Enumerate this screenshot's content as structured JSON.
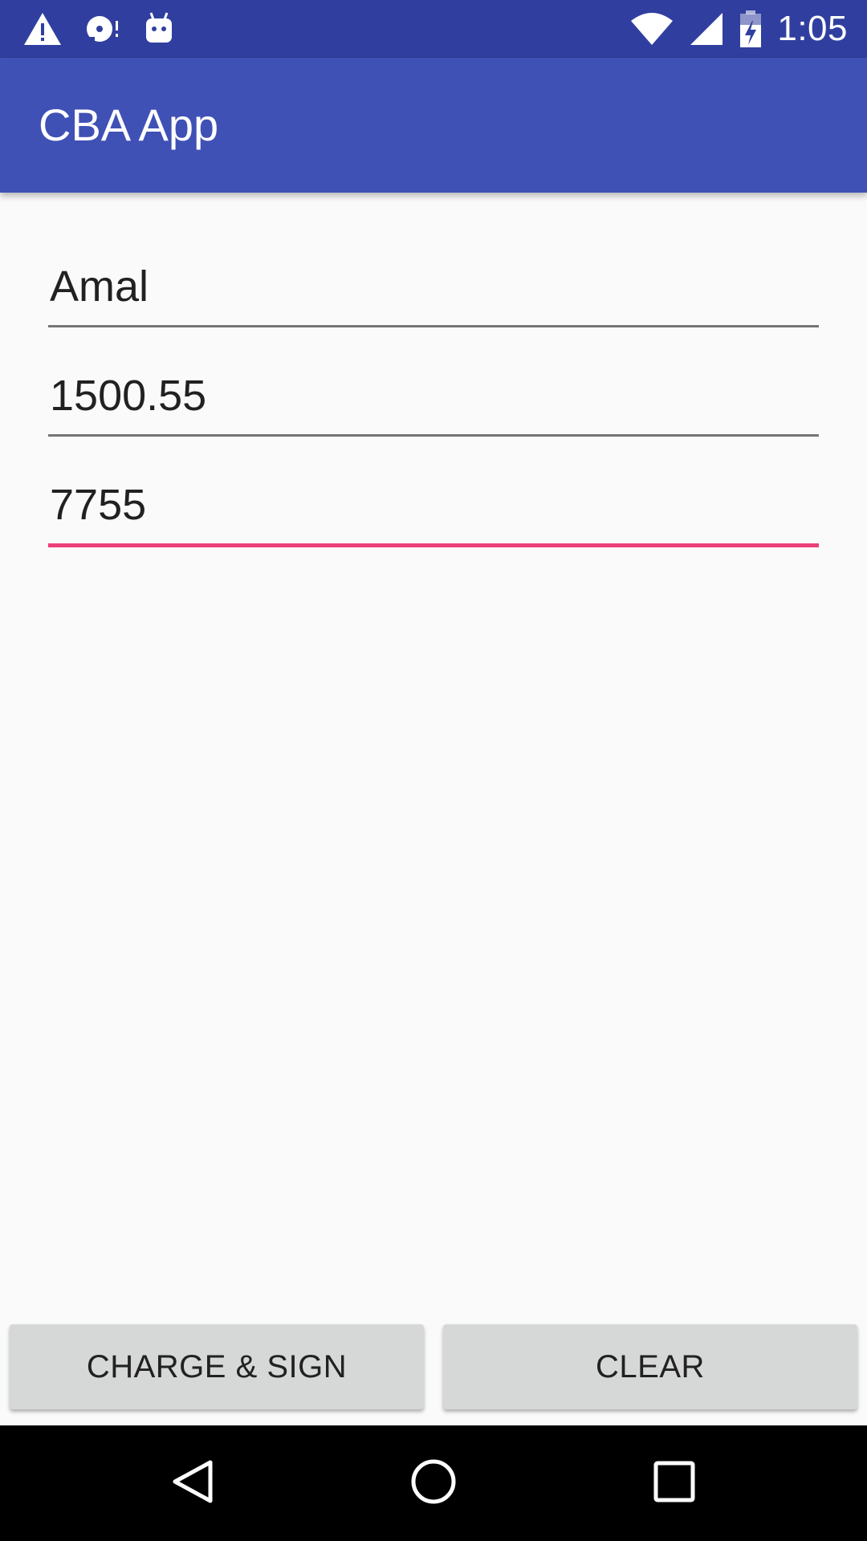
{
  "status_bar": {
    "time": "1:05",
    "icons": [
      "warning-icon",
      "disc-icon",
      "android-icon",
      "wifi-icon",
      "signal-icon",
      "battery-charging-icon"
    ]
  },
  "app_bar": {
    "title": "CBA App"
  },
  "form": {
    "fields": [
      {
        "value": "Amal",
        "focused": false
      },
      {
        "value": "1500.55",
        "focused": false
      },
      {
        "value": "7755",
        "focused": true
      }
    ]
  },
  "buttons": {
    "charge_sign_label": "CHARGE & SIGN",
    "clear_label": "CLEAR"
  },
  "nav_bar": {
    "icons": [
      "back-icon",
      "home-icon",
      "recents-icon"
    ]
  },
  "colors": {
    "status_bar": "#303f9f",
    "app_bar": "#3f51b5",
    "accent": "#ec407a",
    "background": "#fafafa",
    "button": "#d6d7d7"
  }
}
